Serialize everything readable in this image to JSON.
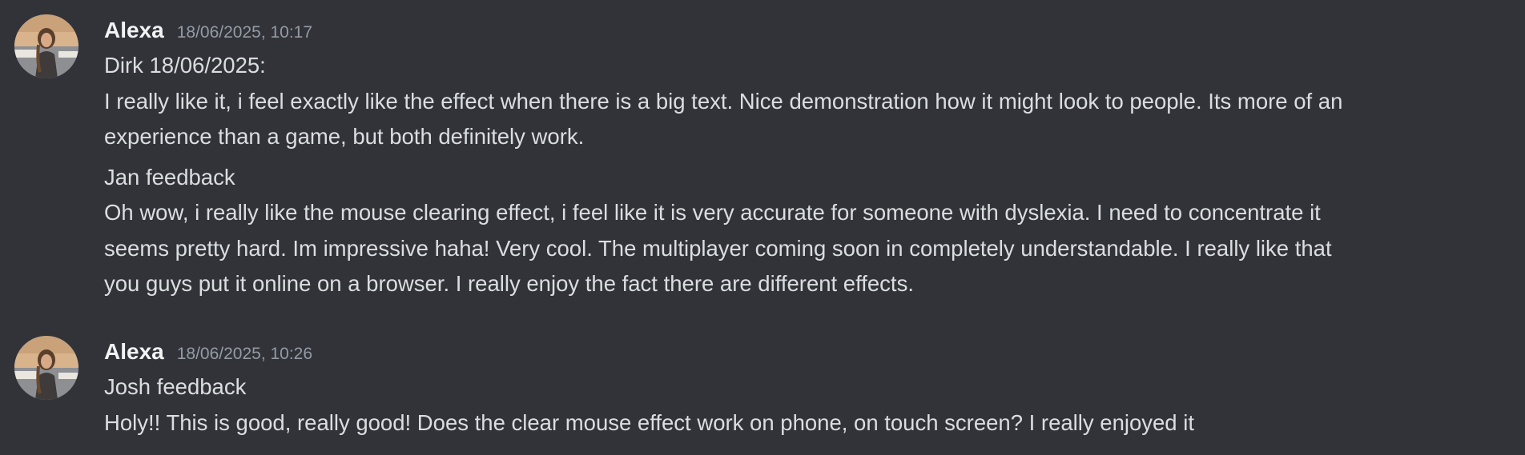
{
  "messages": [
    {
      "author": "Alexa",
      "timestamp": "18/06/2025, 10:17",
      "lines": [
        "Dirk 18/06/2025:",
        "I really like it, i feel exactly like the effect when there is a big text. Nice demonstration how it might look to people. Its more of an",
        "experience than a game, but both definitely work.",
        "Jan feedback",
        "Oh wow, i really like the mouse clearing effect, i feel like it is very accurate for someone with dyslexia. I need to concentrate it",
        "seems pretty hard. Im impressive haha! Very cool. The multiplayer coming soon in completely understandable. I really like that",
        "you guys put it online on a browser. I really enjoy the fact there are different effects."
      ]
    },
    {
      "author": "Alexa",
      "timestamp": "18/06/2025, 10:26",
      "lines": [
        "Josh feedback",
        "Holy!! This is good, really good! Does the clear mouse effect work on phone, on touch screen? I really enjoyed it"
      ]
    }
  ],
  "colors": {
    "background": "#313338",
    "text": "#dbdee1",
    "username": "#f2f3f5",
    "timestamp": "#949ba4"
  },
  "icons": {
    "avatar": "user-avatar-photo"
  }
}
